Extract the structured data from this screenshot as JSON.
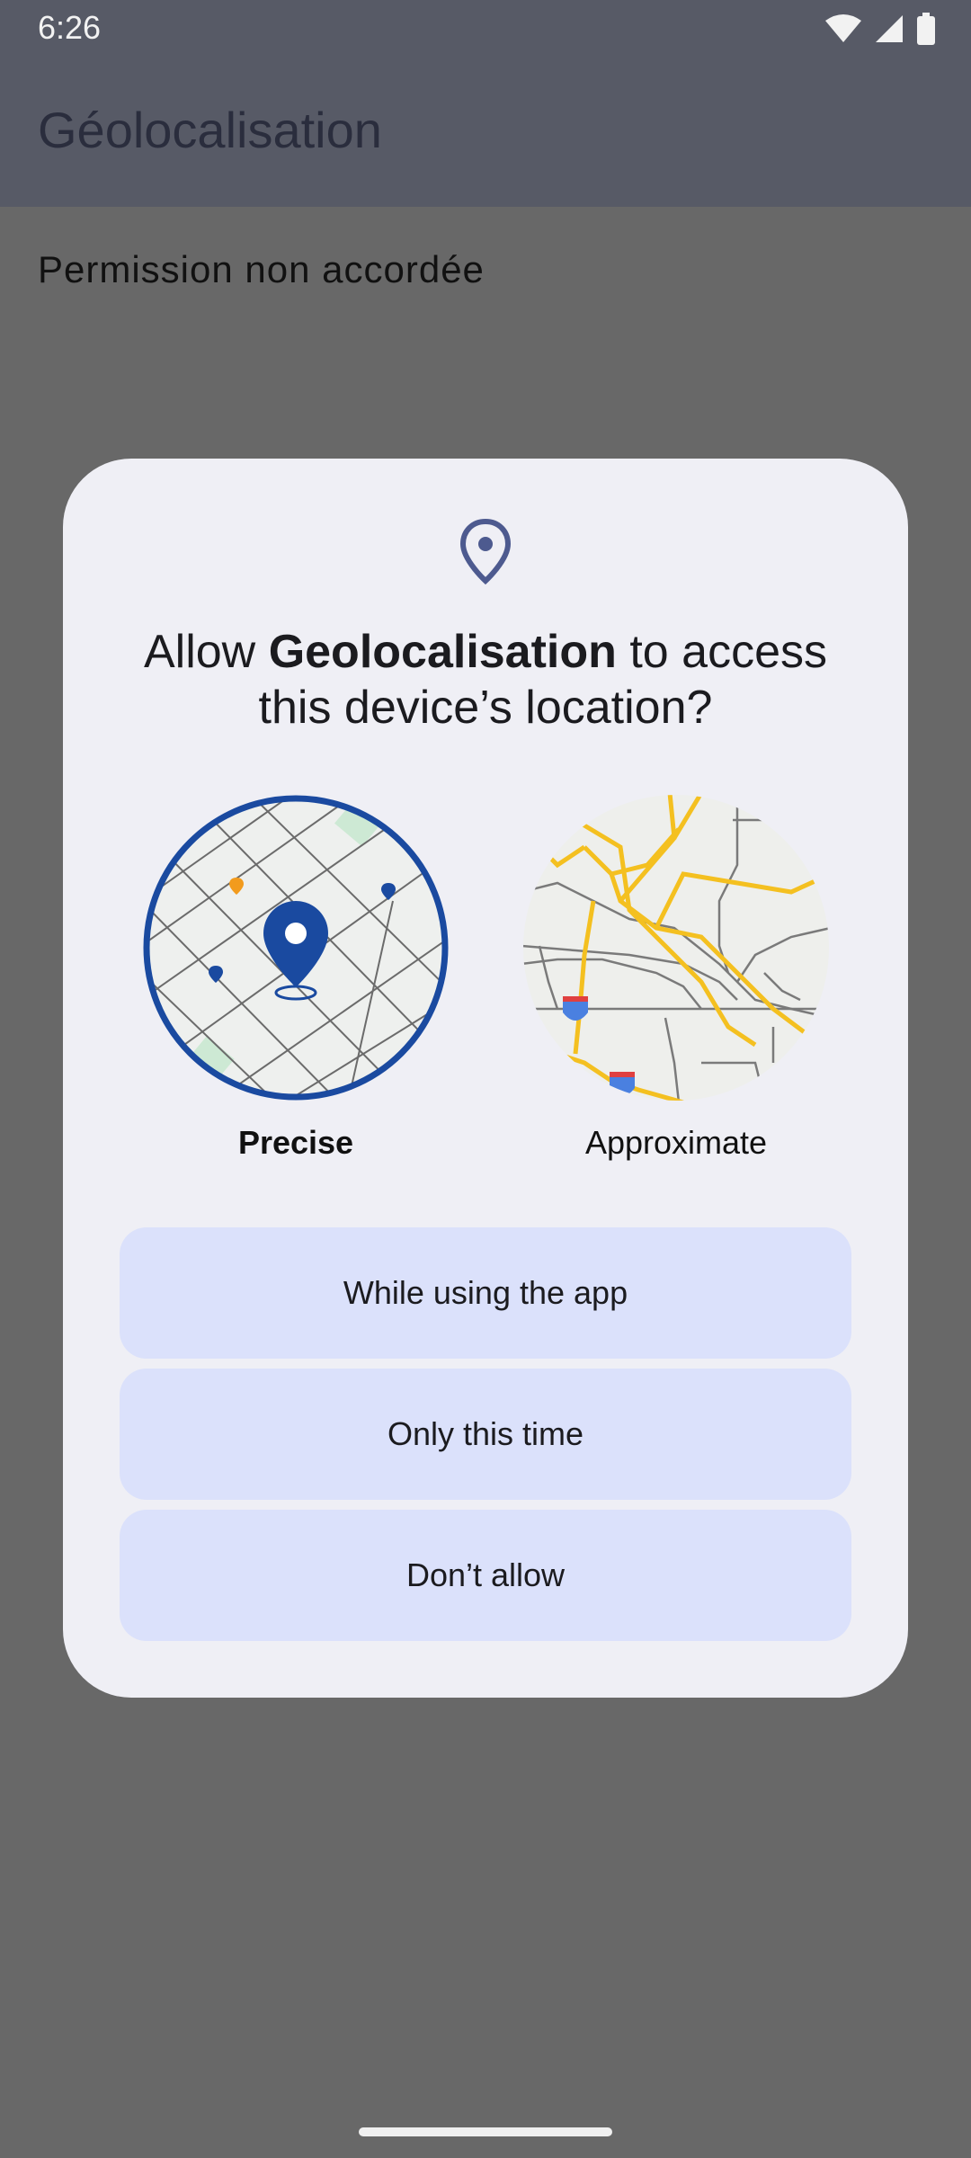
{
  "status_bar": {
    "time": "6:26",
    "icons": [
      "wifi-icon",
      "signal-icon",
      "battery-icon"
    ]
  },
  "app_bar": {
    "title": "Géolocalisation"
  },
  "content": {
    "permission_status": "Permission non accordée"
  },
  "dialog": {
    "icon": "location-pin-icon",
    "title_prefix": "Allow ",
    "title_app": "Geolocalisation",
    "title_suffix": " to access this device’s location?",
    "options": [
      {
        "label": "Precise",
        "selected": true,
        "icon": "precise-map-icon"
      },
      {
        "label": "Approximate",
        "selected": false,
        "icon": "approximate-map-icon"
      }
    ],
    "buttons": [
      {
        "label": "While using the app"
      },
      {
        "label": "Only this time"
      },
      {
        "label": "Don’t allow"
      }
    ]
  },
  "colors": {
    "scrim": "#686868",
    "app_bar": "#575a66",
    "dialog_bg": "#efeff5",
    "button_bg": "#dbe1fb",
    "accent_blue": "#1a4aa0",
    "road_yellow": "#f4c020"
  }
}
